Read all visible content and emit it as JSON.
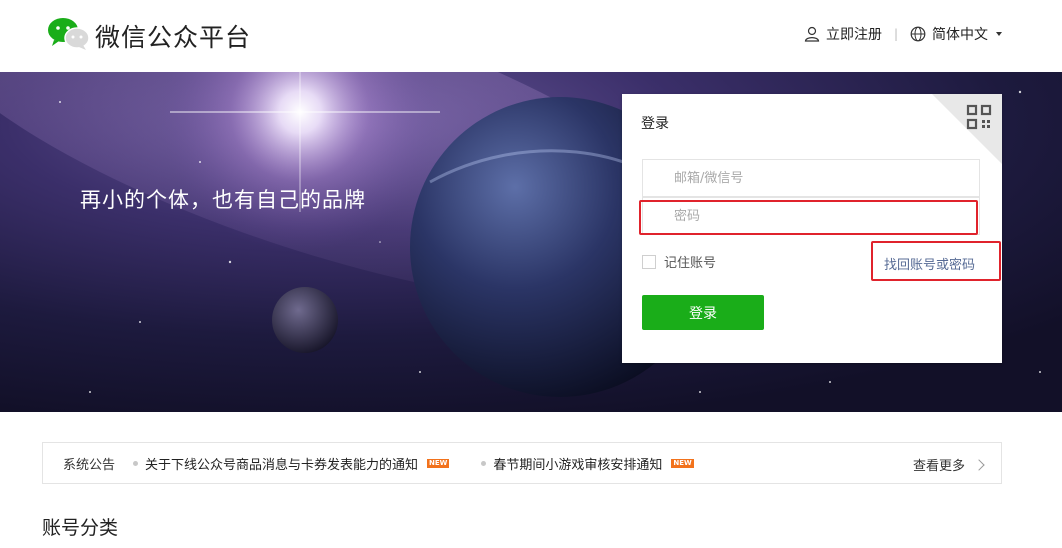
{
  "header": {
    "brand": "微信公众平台",
    "register_label": "立即注册",
    "separator": "|",
    "language_label": "简体中文",
    "icons": {
      "logo": "wechat-logo",
      "register": "user-icon",
      "language": "globe-icon"
    }
  },
  "banner": {
    "slogan": "再小的个体，也有自己的品牌"
  },
  "login": {
    "title": "登录",
    "account_placeholder": "邮箱/微信号",
    "password_placeholder": "密码",
    "remember_label": "记住账号",
    "forgot_label": "找回账号或密码",
    "submit_label": "登录",
    "qr_icon": "qr-code-icon"
  },
  "notice": {
    "label": "系统公告",
    "items": [
      {
        "text": "关于下线公众号商品消息与卡券发表能力的通知",
        "badge": "NEW"
      },
      {
        "text": "春节期间小游戏审核安排通知",
        "badge": "NEW"
      }
    ],
    "more_label": "查看更多"
  },
  "section": {
    "title": "账号分类"
  },
  "colors": {
    "primary_green": "#1aad19",
    "link_blue": "#576b95",
    "highlight_red": "#e0232c",
    "badge_orange": "#f2721c"
  }
}
